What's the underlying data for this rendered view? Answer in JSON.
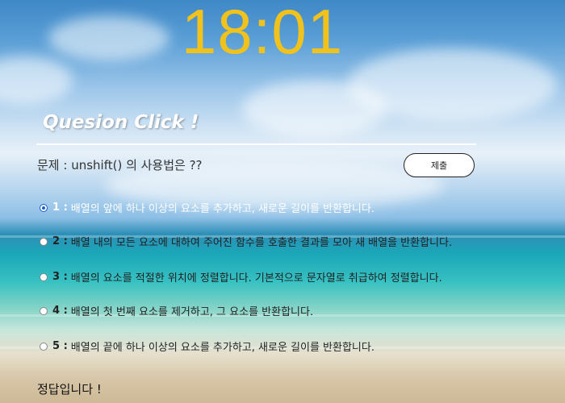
{
  "clock": {
    "time": "18:01"
  },
  "quiz": {
    "title": "Quesion Click !",
    "question": "문제 : unshift() 의 사용법은 ??",
    "submit_label": "제출",
    "options": [
      {
        "num": "1 :",
        "text": "배열의 앞에 하나 이상의 요소를 추가하고, 새로운 길이를 반환합니다.",
        "checked": true
      },
      {
        "num": "2 :",
        "text": "배열 내의 모든 요소에 대하여 주어진 함수를 호출한 결과를 모아 새 배열을 반환합니다.",
        "checked": false
      },
      {
        "num": "3 :",
        "text": "배열의 요소를 적절한 위치에 정렬합니다. 기본적으로 문자열로 취급하여 정렬합니다.",
        "checked": false
      },
      {
        "num": "4 :",
        "text": "배열의 첫 번째 요소를 제거하고, 그 요소를 반환합니다.",
        "checked": false
      },
      {
        "num": "5 :",
        "text": "배열의 끝에 하나 이상의 요소를 추가하고, 새로운 길이를 반환합니다.",
        "checked": false
      }
    ],
    "result": "정답입니다 !"
  },
  "colors": {
    "clock": "#f2c21c",
    "radio_checked": "#1a5fd0"
  }
}
